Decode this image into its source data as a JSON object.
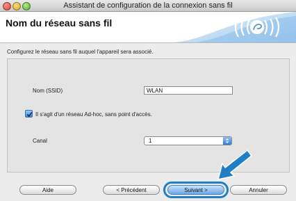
{
  "window": {
    "title": "Assistant de configuration de la connexion sans fil"
  },
  "header": {
    "title": "Nom du réseau sans fil"
  },
  "instruction": "Configurez le réseau sans fil auquel l'appareil sera associé.",
  "ssid": {
    "label": "Nom (SSID)",
    "value": "WLAN"
  },
  "adhoc": {
    "label": "Il s'agit d'un réseau Ad-hoc, sans point d'accès.",
    "checked": true
  },
  "channel": {
    "label": "Canal",
    "value": "1"
  },
  "buttons": {
    "help": "Aide",
    "previous": "< Précédent",
    "next": "Suivant >",
    "cancel": "Annuler"
  },
  "colors": {
    "accent": "#1f7ec4",
    "header_bg": "#ffffff",
    "window_bg": "#ececec"
  },
  "icons": [
    "wifi-signal-icon",
    "checkmark-icon",
    "stepper-arrows-icon",
    "pointer-arrow-icon"
  ]
}
